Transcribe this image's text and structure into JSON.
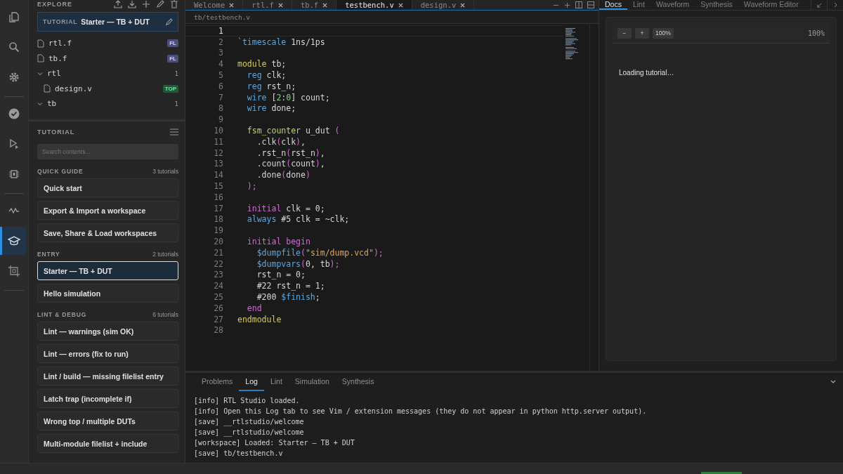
{
  "activity_bar": {
    "items": [
      {
        "selected": false
      },
      {
        "selected": false
      },
      {
        "selected": false
      },
      {
        "selected": false
      },
      {
        "selected": false
      },
      {
        "selected": false
      },
      {
        "selected": false
      },
      {
        "selected": true
      },
      {
        "selected": false
      }
    ]
  },
  "explorer": {
    "title": "EXPLORE",
    "workspace": {
      "tag": "TUTORIAL",
      "name": "Starter — TB + DUT"
    },
    "tree": [
      {
        "kind": "file",
        "name": "rtl.f",
        "badge": "FL",
        "color": "#4b4f7a"
      },
      {
        "kind": "file",
        "name": "tb.f",
        "badge": "FL",
        "color": "#4b4f7a"
      },
      {
        "kind": "folder",
        "name": "rtl",
        "count": "1",
        "expanded": true,
        "children": [
          {
            "kind": "file",
            "name": "design.v",
            "badge": "TOP",
            "color": "#1f5a3a"
          }
        ]
      },
      {
        "kind": "folder",
        "name": "tb",
        "count": "1",
        "expanded": true
      }
    ]
  },
  "tutorial": {
    "title": "TUTORIAL",
    "search": {
      "placeholder": "Search contents..."
    },
    "groups": [
      {
        "title": "QUICK GUIDE",
        "count": "3 tutorials",
        "items": [
          {
            "label": "Quick start",
            "selected": false
          },
          {
            "label": "Export & Import a workspace",
            "selected": false
          },
          {
            "label": "Save, Share & Load workspaces",
            "selected": false
          }
        ]
      },
      {
        "title": "ENTRY",
        "count": "2 tutorials",
        "items": [
          {
            "label": "Starter — TB + DUT",
            "selected": true
          },
          {
            "label": "Hello simulation",
            "selected": false
          }
        ]
      },
      {
        "title": "LINT & DEBUG",
        "count": "6 tutorials",
        "items": [
          {
            "label": "Lint — warnings (sim OK)",
            "selected": false
          },
          {
            "label": "Lint — errors (fix to run)",
            "selected": false
          },
          {
            "label": "Lint / build — missing filelist entry",
            "selected": false
          },
          {
            "label": "Latch trap (incomplete if)",
            "selected": false
          },
          {
            "label": "Wrong top / multiple DUTs",
            "selected": false
          },
          {
            "label": "Multi-module filelist + include",
            "selected": false
          }
        ]
      }
    ]
  },
  "editor": {
    "tabs": [
      {
        "label": "Welcome",
        "selected": false
      },
      {
        "label": "rtl.f",
        "selected": false
      },
      {
        "label": "tb.f",
        "selected": false
      },
      {
        "label": "testbench.v",
        "selected": true
      },
      {
        "label": "design.v",
        "selected": false
      }
    ],
    "breadcrumb": "tb/testbench.v",
    "lines": [
      {
        "number": "1",
        "current": true
      },
      {
        "number": "2",
        "tokens": [
          {
            "t": "`timescale",
            "kind": "type"
          },
          {
            "t": " 1ns/1ps",
            "kind": "plain"
          }
        ]
      },
      {
        "number": "3"
      },
      {
        "number": "4",
        "tokens": [
          {
            "t": "module",
            "kind": "kw"
          },
          {
            "t": " tb;",
            "kind": "plain"
          }
        ]
      },
      {
        "number": "5",
        "tokens": [
          {
            "t": "  reg",
            "kind": "type"
          },
          {
            "t": " clk;",
            "kind": "plain"
          }
        ]
      },
      {
        "number": "6",
        "tokens": [
          {
            "t": "  reg",
            "kind": "type"
          },
          {
            "t": " rst_n;",
            "kind": "plain"
          }
        ]
      },
      {
        "number": "7",
        "tokens": [
          {
            "t": "  wire",
            "kind": "type"
          },
          {
            "t": " [",
            "kind": "plain"
          },
          {
            "t": "2",
            "kind": "num"
          },
          {
            "t": ":",
            "kind": "plain"
          },
          {
            "t": "0",
            "kind": "num"
          },
          {
            "t": "] count;",
            "kind": "plain"
          }
        ]
      },
      {
        "number": "8",
        "tokens": [
          {
            "t": "  wire",
            "kind": "type"
          },
          {
            "t": " done;",
            "kind": "plain"
          }
        ]
      },
      {
        "number": "9"
      },
      {
        "number": "10",
        "tokens": [
          {
            "t": "  fsm_counter",
            "kind": "ident"
          },
          {
            "t": " u_dut ",
            "kind": "plain"
          },
          {
            "t": "(",
            "kind": "paren"
          }
        ]
      },
      {
        "number": "11",
        "tokens": [
          {
            "t": "    .clk",
            "kind": "plain"
          },
          {
            "t": "(",
            "kind": "paren"
          },
          {
            "t": "clk",
            "kind": "plain"
          },
          {
            "t": ")",
            "kind": "paren"
          },
          {
            "t": ",",
            "kind": "plain"
          }
        ]
      },
      {
        "number": "12",
        "tokens": [
          {
            "t": "    .rst_n",
            "kind": "plain"
          },
          {
            "t": "(",
            "kind": "paren"
          },
          {
            "t": "rst_n",
            "kind": "plain"
          },
          {
            "t": ")",
            "kind": "paren"
          },
          {
            "t": ",",
            "kind": "plain"
          }
        ]
      },
      {
        "number": "13",
        "tokens": [
          {
            "t": "    .count",
            "kind": "plain"
          },
          {
            "t": "(",
            "kind": "paren"
          },
          {
            "t": "count",
            "kind": "plain"
          },
          {
            "t": ")",
            "kind": "paren"
          },
          {
            "t": ",",
            "kind": "plain"
          }
        ]
      },
      {
        "number": "14",
        "tokens": [
          {
            "t": "    .done",
            "kind": "plain"
          },
          {
            "t": "(",
            "kind": "paren"
          },
          {
            "t": "done",
            "kind": "plain"
          },
          {
            "t": ")",
            "kind": "paren"
          }
        ]
      },
      {
        "number": "15",
        "tokens": [
          {
            "t": "  );",
            "kind": "paren"
          }
        ]
      },
      {
        "number": "16"
      },
      {
        "number": "17",
        "tokens": [
          {
            "t": "  initial",
            "kind": "ctrl"
          },
          {
            "t": " clk = 0;",
            "kind": "plain"
          }
        ]
      },
      {
        "number": "18",
        "tokens": [
          {
            "t": "  always",
            "kind": "type"
          },
          {
            "t": " #5 clk = ~clk;",
            "kind": "plain"
          }
        ]
      },
      {
        "number": "19"
      },
      {
        "number": "20",
        "tokens": [
          {
            "t": "  initial begin",
            "kind": "ctrl"
          }
        ]
      },
      {
        "number": "21",
        "tokens": [
          {
            "t": "    $dumpfile",
            "kind": "type"
          },
          {
            "t": "(",
            "kind": "paren"
          },
          {
            "t": "\"sim/dump.vcd\"",
            "kind": "str"
          },
          {
            "t": ");",
            "kind": "paren"
          }
        ]
      },
      {
        "number": "22",
        "tokens": [
          {
            "t": "    $dumpvars",
            "kind": "type"
          },
          {
            "t": "(",
            "kind": "paren"
          },
          {
            "t": "0, tb",
            "kind": "plain"
          },
          {
            "t": ");",
            "kind": "paren"
          }
        ]
      },
      {
        "number": "23",
        "tokens": [
          {
            "t": "    rst_n = 0;",
            "kind": "plain"
          }
        ]
      },
      {
        "number": "24",
        "tokens": [
          {
            "t": "    #22 rst_n = 1;",
            "kind": "plain"
          }
        ]
      },
      {
        "number": "25",
        "tokens": [
          {
            "t": "    #200 ",
            "kind": "plain"
          },
          {
            "t": "$finish",
            "kind": "type"
          },
          {
            "t": ";",
            "kind": "plain"
          }
        ]
      },
      {
        "number": "26",
        "tokens": [
          {
            "t": "  end",
            "kind": "ctrl"
          }
        ]
      },
      {
        "number": "27",
        "tokens": [
          {
            "t": "endmodule",
            "kind": "kw"
          }
        ]
      },
      {
        "number": "28"
      }
    ]
  },
  "right_panel": {
    "tabs": [
      {
        "label": "Docs",
        "selected": true
      },
      {
        "label": "Lint",
        "selected": false
      },
      {
        "label": "Waveform",
        "selected": false
      },
      {
        "label": "Synthesis",
        "selected": false
      },
      {
        "label": "Waveform Editor",
        "selected": false
      }
    ],
    "zoom_buttons": [
      "−",
      "+",
      "100%"
    ],
    "zoom_reading": "100%",
    "message": "Loading tutorial…"
  },
  "bottom_panel": {
    "tabs": [
      {
        "label": "Problems",
        "selected": false
      },
      {
        "label": "Log",
        "selected": true
      },
      {
        "label": "Lint",
        "selected": false
      },
      {
        "label": "Simulation",
        "selected": false
      },
      {
        "label": "Synthesis",
        "selected": false
      }
    ],
    "log": [
      "[info] RTL Studio loaded.",
      "[info] Open this Log tab to see Vim / extension messages (they do not appear in python http.server output).",
      "[save] __rtlstudio/welcome",
      "[save] __rtlstudio/welcome",
      "[workspace] Loaded: Starter — TB + DUT",
      "[save] tb/testbench.v"
    ]
  }
}
